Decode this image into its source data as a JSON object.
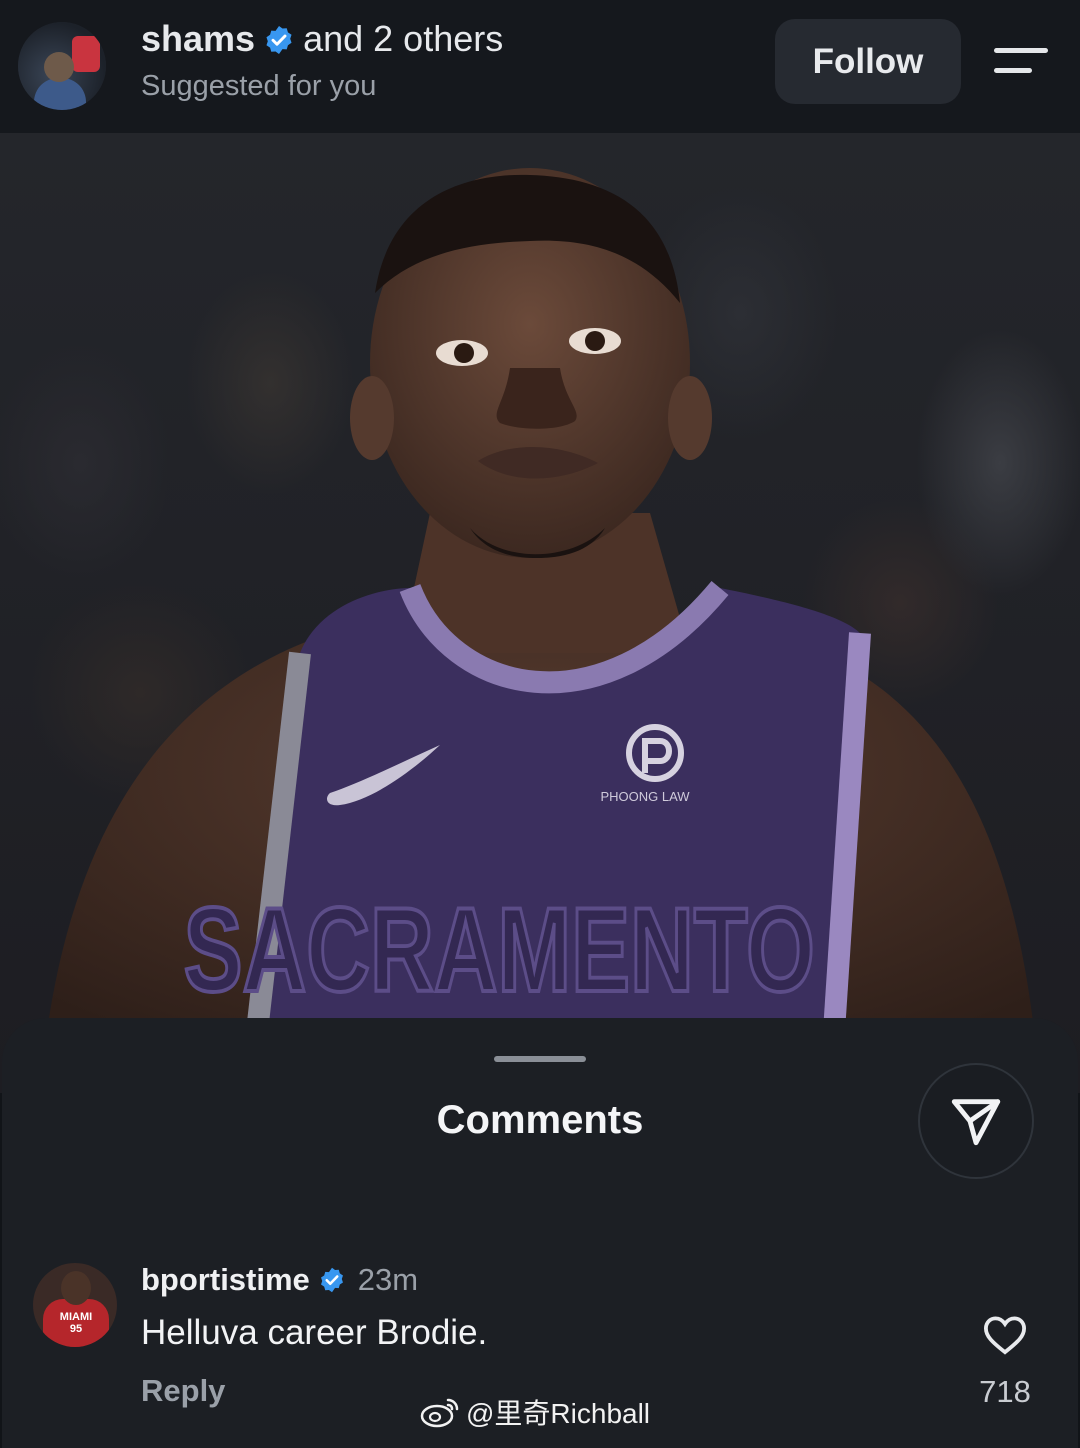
{
  "header": {
    "username": "shams",
    "others_text": "and 2 others",
    "subtitle": "Suggested for you",
    "follow_label": "Follow"
  },
  "photo": {
    "jersey_sponsor": "PHOONG LAW",
    "jersey_wordmark": "SACRAMENTO"
  },
  "comments_sheet": {
    "title": "Comments",
    "comments": [
      {
        "username": "bportistime",
        "time": "23m",
        "text": "Helluva career Brodie.",
        "reply_label": "Reply",
        "like_count": "718",
        "avatar_jersey_text": "MIAMI 95"
      }
    ]
  },
  "watermark": {
    "text": "@里奇Richball"
  },
  "colors": {
    "background": "#111418",
    "sheet": "#1c1f24",
    "verified": "#3897f0",
    "follow_button": "#262a31",
    "jersey_purple": "#3b2f5e"
  },
  "icons": [
    "verified-badge-icon",
    "hamburger-menu-icon",
    "send-icon",
    "heart-icon",
    "weibo-icon"
  ]
}
